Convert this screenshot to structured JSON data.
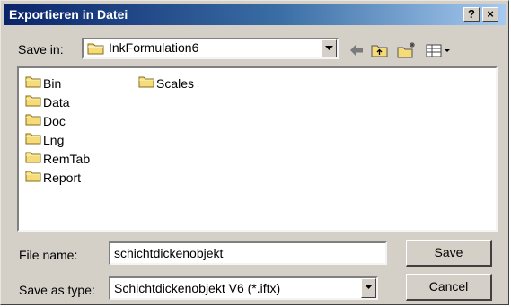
{
  "window": {
    "title": "Exportieren in Datei",
    "help_button": "?",
    "close_button": "×"
  },
  "save_in": {
    "label": "Save in:",
    "value": "InkFormulation6"
  },
  "toolbar": {
    "icons": [
      "back-arrow-icon",
      "up-folder-icon",
      "new-folder-icon",
      "view-menu-icon"
    ]
  },
  "folders": [
    {
      "name": "Bin"
    },
    {
      "name": "Data"
    },
    {
      "name": "Doc"
    },
    {
      "name": "Lng"
    },
    {
      "name": "RemTab"
    },
    {
      "name": "Report"
    },
    {
      "name": "Scales"
    }
  ],
  "file_name": {
    "label": "File name:",
    "value": "schichtdickenobjekt"
  },
  "save_as_type": {
    "label": "Save as type:",
    "value": "Schichtdickenobjekt V6 (*.iftx)"
  },
  "buttons": {
    "save": "Save",
    "cancel": "Cancel"
  },
  "colors": {
    "title_bar_start": "#0a246a",
    "title_bar_end": "#a6caf0",
    "dialog_face": "#d4d0c8",
    "folder_yellow": "#f6dc78"
  }
}
